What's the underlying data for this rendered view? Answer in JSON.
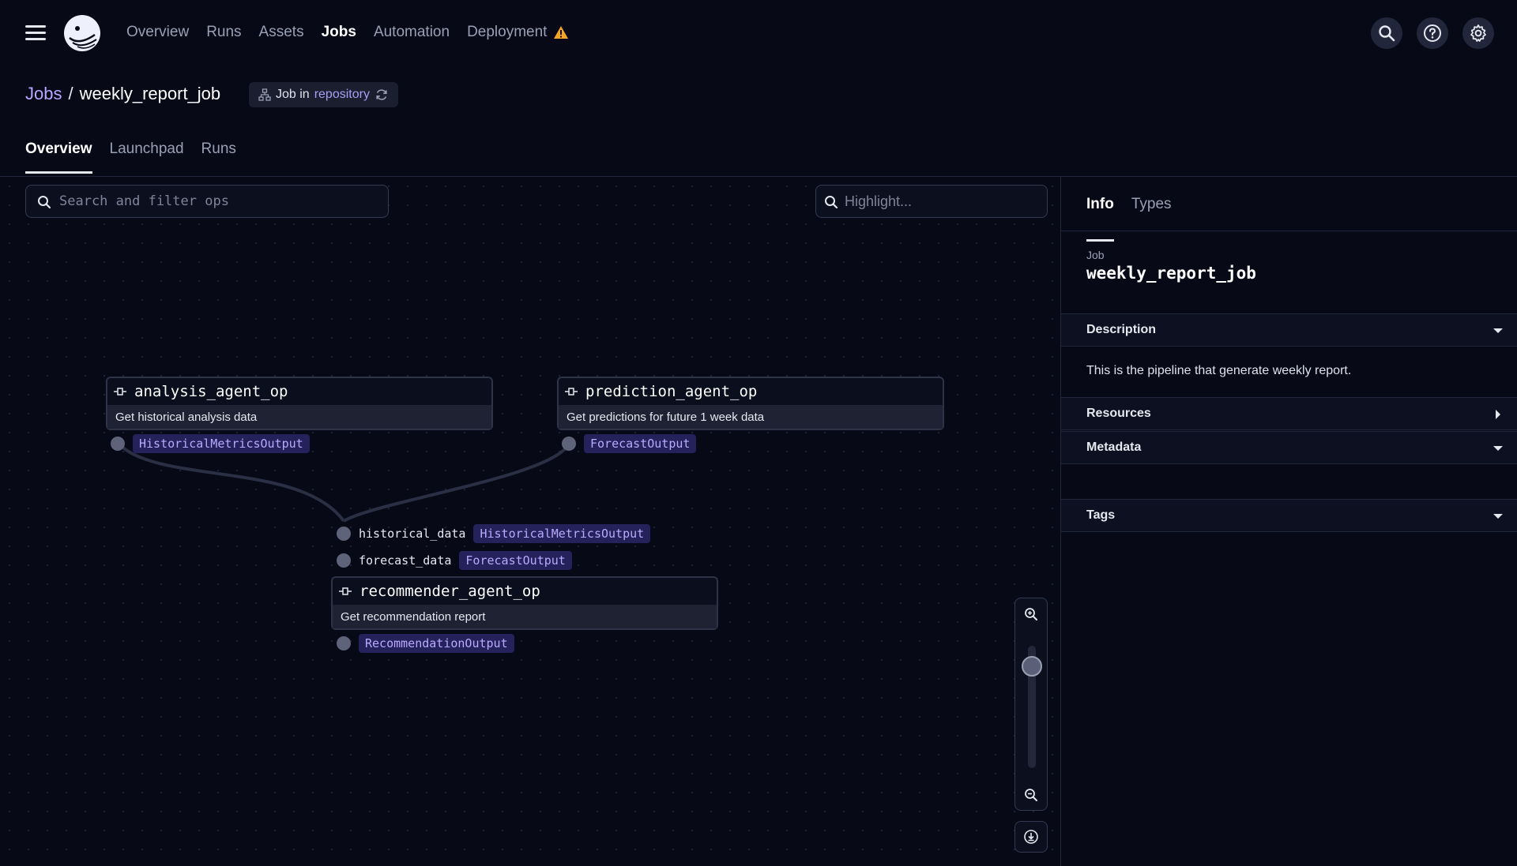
{
  "nav": {
    "items": [
      {
        "label": "Overview",
        "active": false
      },
      {
        "label": "Runs",
        "active": false
      },
      {
        "label": "Assets",
        "active": false
      },
      {
        "label": "Jobs",
        "active": true
      },
      {
        "label": "Automation",
        "active": false
      },
      {
        "label": "Deployment",
        "active": false
      }
    ],
    "icons": [
      "search-icon",
      "help-icon",
      "gear-icon"
    ]
  },
  "breadcrumb": {
    "parent": "Jobs",
    "separator": "/",
    "current": "weekly_report_job"
  },
  "job_badge": {
    "prefix": "Job in",
    "repo": "repository"
  },
  "tabs": [
    {
      "label": "Overview",
      "active": true
    },
    {
      "label": "Launchpad",
      "active": false
    },
    {
      "label": "Runs",
      "active": false
    }
  ],
  "graph": {
    "search_placeholder": "Search and filter ops",
    "highlight_placeholder": "Highlight...",
    "ops": [
      {
        "name": "analysis_agent_op",
        "description": "Get historical analysis data",
        "output_type": "HistoricalMetricsOutput"
      },
      {
        "name": "prediction_agent_op",
        "description": "Get predictions for future 1 week data",
        "output_type": "ForecastOutput"
      },
      {
        "name": "recommender_agent_op",
        "description": "Get recommendation report",
        "inputs": [
          {
            "name": "historical_data",
            "type": "HistoricalMetricsOutput"
          },
          {
            "name": "forecast_data",
            "type": "ForecastOutput"
          }
        ],
        "output_type": "RecommendationOutput"
      }
    ]
  },
  "side": {
    "tabs": [
      {
        "label": "Info",
        "active": true
      },
      {
        "label": "Types",
        "active": false
      }
    ],
    "job_label": "Job",
    "job_name": "weekly_report_job",
    "sections": {
      "description": {
        "title": "Description",
        "text": "This is the pipeline that generate weekly report."
      },
      "resources": {
        "title": "Resources"
      },
      "metadata": {
        "title": "Metadata"
      },
      "tags": {
        "title": "Tags"
      }
    }
  },
  "colors": {
    "accent": "#b8a6ff",
    "warning": "#f5a524",
    "background": "#070917"
  }
}
